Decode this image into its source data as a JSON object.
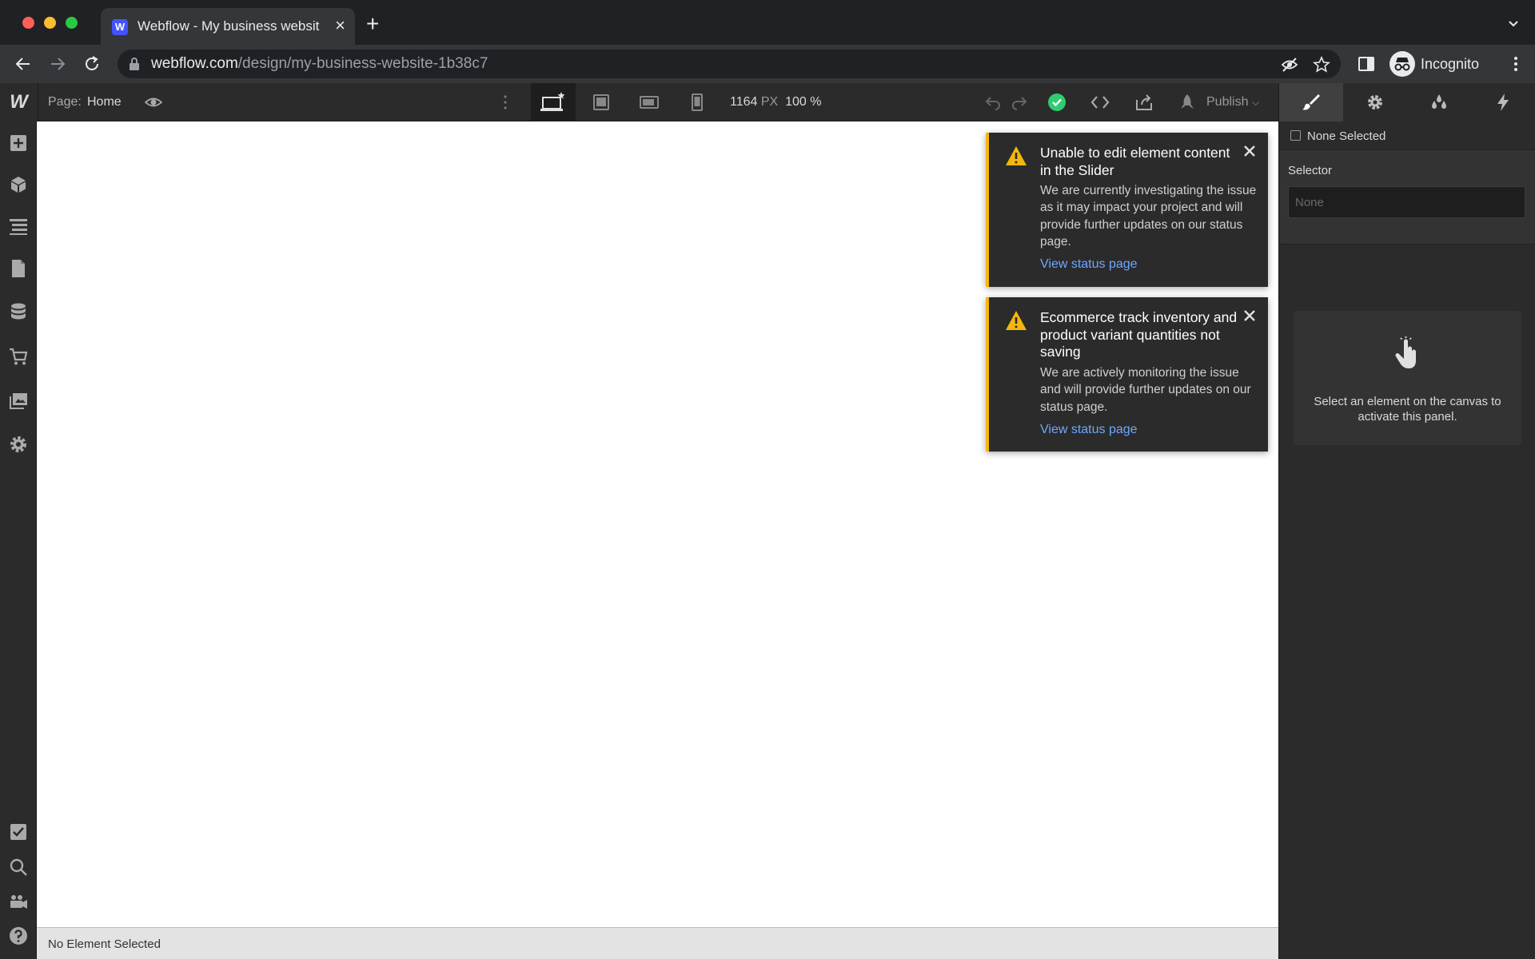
{
  "browser": {
    "tab_title": "Webflow - My business websit",
    "tab_favicon": "W",
    "url_domain": "webflow.com",
    "url_path": "/design/my-business-website-1b38c7",
    "profile_label": "Incognito"
  },
  "designer": {
    "logo": "W",
    "page_label": "Page:",
    "page_name": "Home",
    "canvas_width": "1164",
    "canvas_width_unit": "PX",
    "zoom": "100 %",
    "publish_label": "Publish",
    "status_text": "No Element Selected"
  },
  "notifications": [
    {
      "title": "Unable to edit element content in the Slider",
      "body": "We are currently investigating the issue as it may impact your project and will provide further updates on our status page.",
      "link": "View status page"
    },
    {
      "title": "Ecommerce track inventory and product variant quantities not saving",
      "body": "We are actively monitoring the issue and will provide further updates on our status page.",
      "link": "View status page"
    }
  ],
  "right_panel": {
    "none_selected": "None Selected",
    "selector_label": "Selector",
    "selector_placeholder": "None",
    "empty_message": "Select an element on the canvas to activate this panel."
  },
  "colors": {
    "warning": "#f5b70c",
    "link": "#6fa8ff",
    "success": "#2ecc71",
    "brand": "#4353ff"
  }
}
